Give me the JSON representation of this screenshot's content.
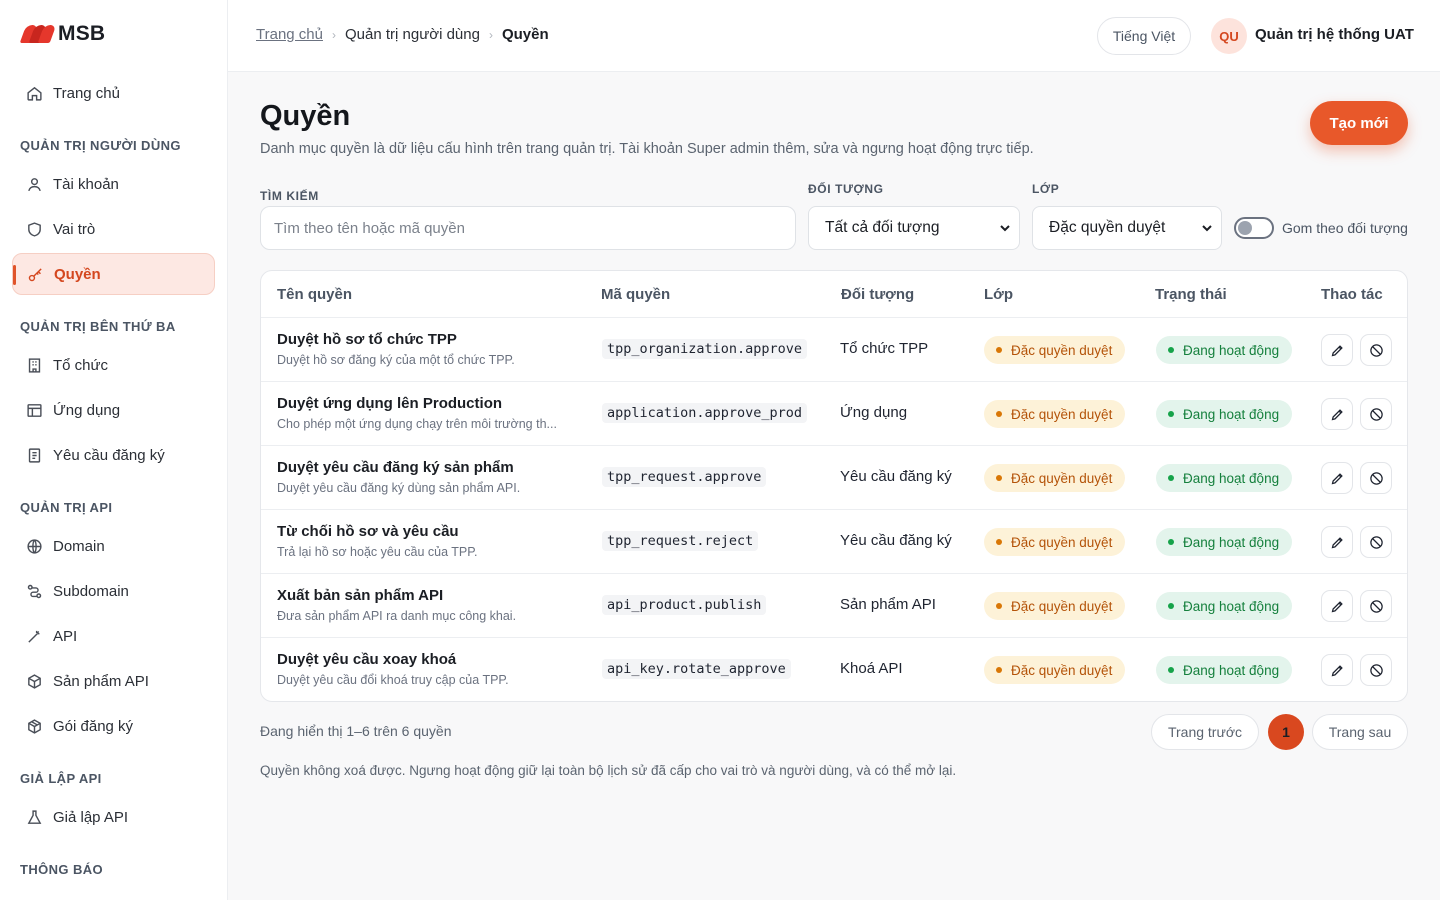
{
  "brand": {
    "name": "MSB"
  },
  "sidebar": {
    "home": "Trang chủ",
    "sections": [
      {
        "title": "QUẢN TRỊ NGƯỜI DÙNG",
        "items": [
          "Tài khoản",
          "Vai trò",
          "Quyền"
        ]
      },
      {
        "title": "QUẢN TRỊ BÊN THỨ BA",
        "items": [
          "Tổ chức",
          "Ứng dụng",
          "Yêu cầu đăng ký"
        ]
      },
      {
        "title": "QUẢN TRỊ API",
        "items": [
          "Domain",
          "Subdomain",
          "API",
          "Sản phẩm API",
          "Gói đăng ký"
        ]
      },
      {
        "title": "GIẢ LẬP API",
        "items": [
          "Giả lập API"
        ]
      },
      {
        "title": "THÔNG BÁO",
        "items": []
      }
    ],
    "active_item": "Quyền"
  },
  "topbar": {
    "breadcrumb": [
      "Trang chủ",
      "Quản trị người dùng",
      "Quyền"
    ],
    "language": "Tiếng Việt",
    "avatar_initials": "QU",
    "user_name": "Quản trị hệ thống UAT"
  },
  "page": {
    "title": "Quyền",
    "description": "Danh mục quyền là dữ liệu cấu hình trên trang quản trị. Tài khoản Super admin thêm, sửa và ngưng hoạt động trực tiếp.",
    "create_label": "Tạo mới"
  },
  "filters": {
    "search_label": "TÌM KIẾM",
    "search_placeholder": "Tìm theo tên hoặc mã quyền",
    "object_label": "ĐỐI TƯỢNG",
    "object_value": "Tất cả đối tượng",
    "class_label": "LỚP",
    "class_value": "Đặc quyền duyệt",
    "group_toggle_label": "Gom theo đối tượng",
    "group_toggle_on": false
  },
  "table": {
    "columns": [
      "Tên quyền",
      "Mã quyền",
      "Đối tượng",
      "Lớp",
      "Trạng thái",
      "Thao tác"
    ],
    "rows": [
      {
        "name": "Duyệt hồ sơ tổ chức TPP",
        "desc": "Duyệt hồ sơ đăng ký của một tổ chức TPP.",
        "code": "tpp_organization.approve",
        "object": "Tổ chức TPP",
        "class": "Đặc quyền duyệt",
        "status": "Đang hoạt động"
      },
      {
        "name": "Duyệt ứng dụng lên Production",
        "desc": "Cho phép một ứng dụng chạy trên môi trường th...",
        "code": "application.approve_prod",
        "object": "Ứng dụng",
        "class": "Đặc quyền duyệt",
        "status": "Đang hoạt động"
      },
      {
        "name": "Duyệt yêu cầu đăng ký sản phẩm",
        "desc": "Duyệt yêu cầu đăng ký dùng sản phẩm API.",
        "code": "tpp_request.approve",
        "object": "Yêu cầu đăng ký",
        "class": "Đặc quyền duyệt",
        "status": "Đang hoạt động"
      },
      {
        "name": "Từ chối hồ sơ và yêu cầu",
        "desc": "Trả lại hồ sơ hoặc yêu cầu của TPP.",
        "code": "tpp_request.reject",
        "object": "Yêu cầu đăng ký",
        "class": "Đặc quyền duyệt",
        "status": "Đang hoạt động"
      },
      {
        "name": "Xuất bản sản phẩm API",
        "desc": "Đưa sản phẩm API ra danh mục công khai.",
        "code": "api_product.publish",
        "object": "Sản phẩm API",
        "class": "Đặc quyền duyệt",
        "status": "Đang hoạt động"
      },
      {
        "name": "Duyệt yêu cầu xoay khoá",
        "desc": "Duyệt yêu cầu đổi khoá truy cập của TPP.",
        "code": "api_key.rotate_approve",
        "object": "Khoá API",
        "class": "Đặc quyền duyệt",
        "status": "Đang hoạt động"
      }
    ]
  },
  "pagination": {
    "showing": "Đang hiển thị 1–6 trên 6 quyền",
    "prev": "Trang trước",
    "current": "1",
    "next": "Trang sau"
  },
  "footnote": "Quyền không xoá được. Ngưng hoạt động giữ lại toàn bộ lịch sử đã cấp cho vai trò và người dùng, và có thể mở lại.",
  "colors": {
    "accent": "#e8582a",
    "active_bg": "#fde8e3",
    "warn_badge": "#fdf2d8",
    "ok_badge": "#e3f4ec"
  }
}
